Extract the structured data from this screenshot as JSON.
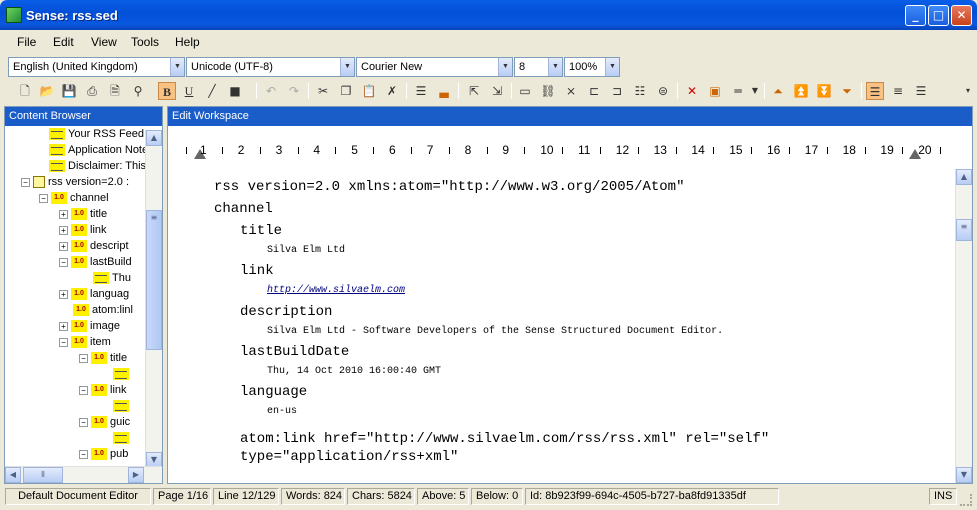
{
  "window": {
    "title": "Sense: rss.sed"
  },
  "menu": [
    "File",
    "Edit",
    "View",
    "Tools",
    "Help"
  ],
  "format": {
    "language": "English (United Kingdom)",
    "encoding": "Unicode (UTF-8)",
    "font": "Courier New",
    "size": "8",
    "zoom": "100%"
  },
  "toolbar": {
    "bold": "B",
    "underline": "U"
  },
  "left_panel": {
    "title": "Content Browser",
    "tree": [
      {
        "label": "Your RSS Feed",
        "icon": "text-item-icon",
        "depth": 1,
        "expander": ""
      },
      {
        "label": "Application Note",
        "icon": "text-item-icon",
        "depth": 1,
        "expander": ""
      },
      {
        "label": "Disclaimer: This",
        "icon": "text-item-icon",
        "depth": 1,
        "expander": ""
      },
      {
        "label": "rss version=2.0 :",
        "icon": "document-icon",
        "depth": 0,
        "expander": "−"
      },
      {
        "label": "channel",
        "icon": "element-icon",
        "depth": 1,
        "expander": "−"
      },
      {
        "label": "title",
        "icon": "element-icon",
        "depth": 2,
        "expander": "+"
      },
      {
        "label": "link",
        "icon": "element-icon",
        "depth": 2,
        "expander": "+"
      },
      {
        "label": "descript",
        "icon": "element-icon",
        "depth": 2,
        "expander": "+"
      },
      {
        "label": "lastBuild",
        "icon": "element-icon",
        "depth": 2,
        "expander": "−"
      },
      {
        "label": "Thu",
        "icon": "text-item-icon",
        "depth": 3,
        "expander": ""
      },
      {
        "label": "languag",
        "icon": "element-icon",
        "depth": 2,
        "expander": "+"
      },
      {
        "label": "atom:linl",
        "icon": "element-icon",
        "depth": 2,
        "expander": ""
      },
      {
        "label": "image",
        "icon": "element-icon",
        "depth": 2,
        "expander": "+"
      },
      {
        "label": "item",
        "icon": "element-icon",
        "depth": 2,
        "expander": "−"
      },
      {
        "label": "title",
        "icon": "element-icon",
        "depth": 3,
        "expander": "−"
      },
      {
        "label": "",
        "icon": "text-item-icon",
        "depth": 4,
        "expander": ""
      },
      {
        "label": "link",
        "icon": "element-icon",
        "depth": 3,
        "expander": "−"
      },
      {
        "label": "",
        "icon": "text-item-icon",
        "depth": 4,
        "expander": ""
      },
      {
        "label": "guic",
        "icon": "element-icon",
        "depth": 3,
        "expander": "−"
      },
      {
        "label": "",
        "icon": "text-item-icon",
        "depth": 4,
        "expander": ""
      },
      {
        "label": "pub",
        "icon": "element-icon",
        "depth": 3,
        "expander": "−"
      }
    ],
    "element_badge": "1.0"
  },
  "right_panel": {
    "title": "Edit Workspace",
    "ruler": [
      "1",
      "2",
      "3",
      "4",
      "5",
      "6",
      "7",
      "8",
      "9",
      "10",
      "11",
      "12",
      "13",
      "14",
      "15",
      "16",
      "17",
      "18",
      "19",
      "20"
    ],
    "lines": [
      {
        "text": "rss version=2.0 xmlns:atom=\"http://www.w3.org/2005/Atom\"",
        "kind": "el",
        "indent": 0
      },
      {
        "text": "channel",
        "kind": "el",
        "indent": 0
      },
      {
        "text": "title",
        "kind": "el",
        "indent": 1
      },
      {
        "text": "Silva Elm Ltd",
        "kind": "val",
        "indent": 2
      },
      {
        "text": "link",
        "kind": "el",
        "indent": 1
      },
      {
        "text": "http://www.silvaelm.com",
        "kind": "link",
        "indent": 2
      },
      {
        "text": "description",
        "kind": "el",
        "indent": 1
      },
      {
        "text": "Silva Elm Ltd - Software Developers of the Sense Structured Document Editor.",
        "kind": "val",
        "indent": 2
      },
      {
        "text": "lastBuildDate",
        "kind": "el",
        "indent": 1
      },
      {
        "text": "Thu, 14 Oct 2010 16:00:40 GMT",
        "kind": "val",
        "indent": 2
      },
      {
        "text": "language",
        "kind": "el",
        "indent": 1
      },
      {
        "text": "en-us",
        "kind": "val",
        "indent": 2
      },
      {
        "text": "atom:link href=\"http://www.silvaelm.com/rss/rss.xml\" rel=\"self\"",
        "kind": "el",
        "indent": 1
      },
      {
        "text": "type=\"application/rss+xml\"",
        "kind": "el",
        "indent": 1
      }
    ]
  },
  "status": {
    "editor": "Default Document Editor",
    "page": "Page 1/16",
    "line": "Line 12/129",
    "words": "Words: 824",
    "chars": "Chars: 5824",
    "above": "Above: 5",
    "below": "Below: 0",
    "id": "Id: 8b923f99-694c-4505-b727-ba8fd91335df",
    "mode": "INS"
  }
}
